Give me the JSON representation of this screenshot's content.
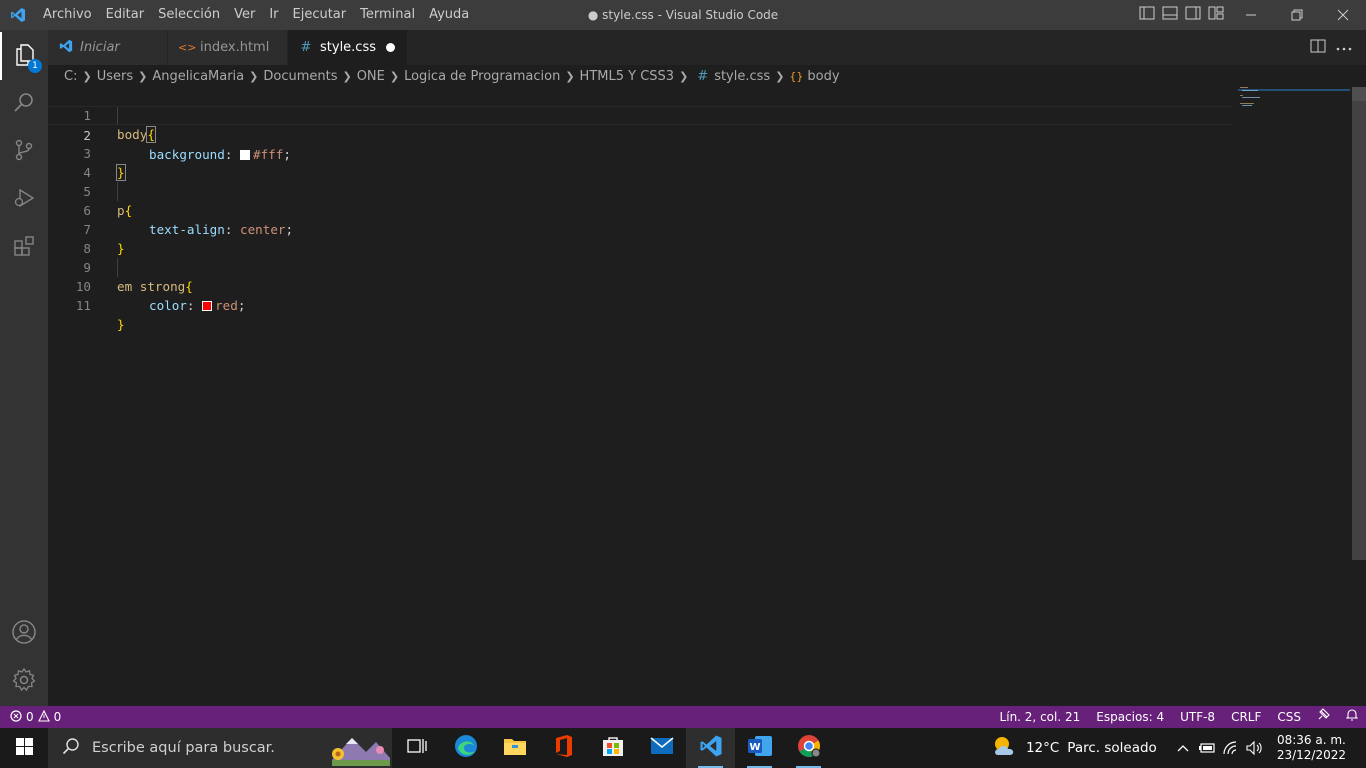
{
  "window": {
    "title": "● style.css - Visual Studio Code"
  },
  "menu": [
    "Archivo",
    "Editar",
    "Selección",
    "Ver",
    "Ir",
    "Ejecutar",
    "Terminal",
    "Ayuda"
  ],
  "activity": {
    "explorer_badge": "1"
  },
  "tabs": [
    {
      "label": "Iniciar",
      "icon": "vscode-icon",
      "italic": true
    },
    {
      "label": "index.html",
      "icon": "html-icon",
      "glyph": "<>"
    },
    {
      "label": "style.css",
      "icon": "css-hash-icon",
      "glyph": "#",
      "active": true,
      "dirty": true
    }
  ],
  "breadcrumb": [
    "C:",
    "Users",
    "AngelicaMaria",
    "Documents",
    "ONE",
    "Logica de Programacion",
    "HTML5 Y CSS3",
    "style.css",
    "body"
  ],
  "breadcrumb_icons": {
    "file": "#",
    "symbol": "{}"
  },
  "editor": {
    "current_line": 2,
    "line_numbers": [
      "1",
      "2",
      "3",
      "4",
      "5",
      "6",
      "7",
      "8",
      "9",
      "10",
      "11"
    ],
    "code": {
      "l1_selector": "body",
      "l1_brace": "{",
      "l2_prop": "background",
      "l2_colon": ": ",
      "l2_value": "#fff",
      "l2_semi": ";",
      "l2_swatch": "#ffffff",
      "l3_brace": "}",
      "l5_selector": "p",
      "l5_brace": "{",
      "l6_prop": "text-align",
      "l6_colon": ": ",
      "l6_value": "center",
      "l6_semi": ";",
      "l7_brace": "}",
      "l9_selector": "em strong",
      "l9_brace": "{",
      "l10_prop": "color",
      "l10_colon": ": ",
      "l10_value": "red",
      "l10_semi": ";",
      "l10_swatch": "#ff0000",
      "l11_brace": "}"
    }
  },
  "statusbar": {
    "errors": "0",
    "warnings": "0",
    "position": "Lín. 2, col. 21",
    "spaces": "Espacios: 4",
    "encoding": "UTF-8",
    "eol": "CRLF",
    "language": "CSS",
    "color": "#68217a"
  },
  "taskbar": {
    "search_placeholder": "Escribe aquí para buscar.",
    "weather_temp": "12°C",
    "weather_desc": "Parc. soleado",
    "time": "08:36 a. m.",
    "date": "23/12/2022"
  }
}
